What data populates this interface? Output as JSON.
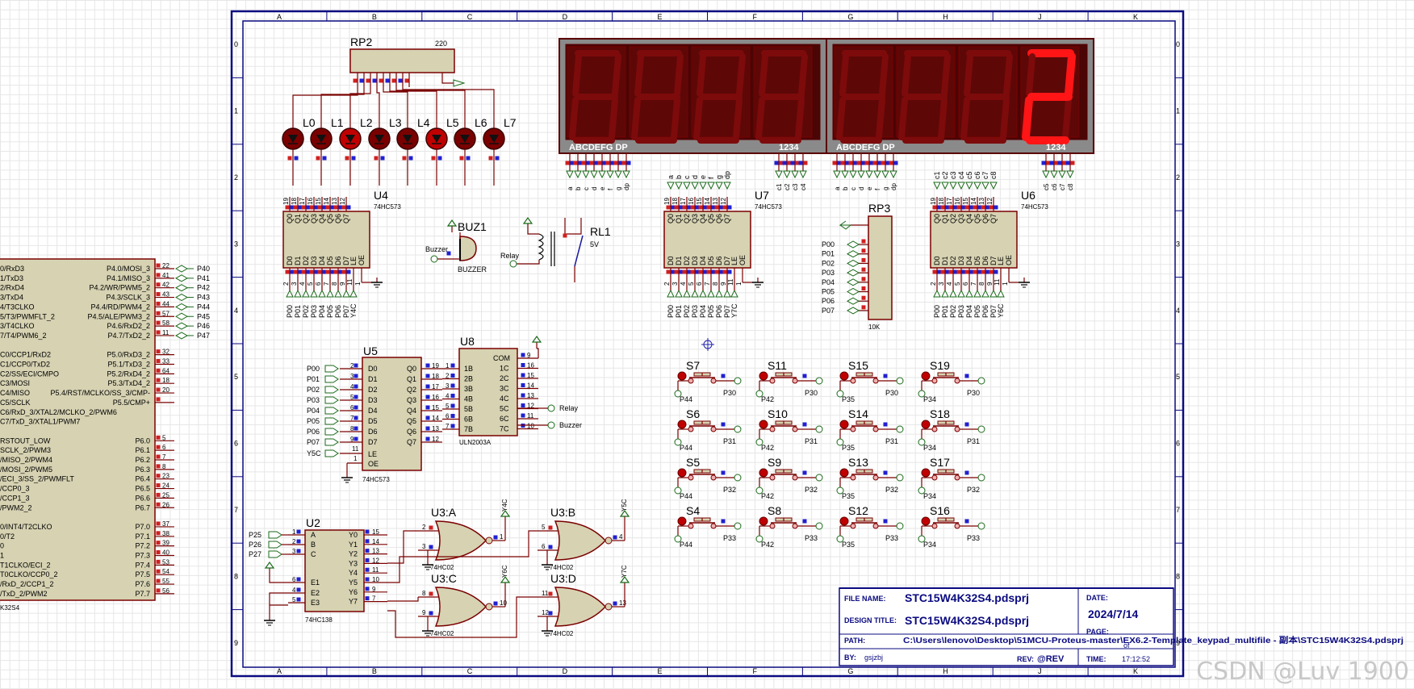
{
  "border_cols": [
    "A",
    "B",
    "C",
    "D",
    "E",
    "F",
    "G",
    "H",
    "J",
    "K"
  ],
  "border_rows": [
    "0",
    "1",
    "2",
    "3",
    "4",
    "5",
    "6",
    "7",
    "8",
    "9"
  ],
  "colors": {
    "wire": "#7a0000",
    "part_fill": "#d6d2b2",
    "part_stroke": "#7a0000",
    "display_bg": "#5a0000",
    "segment_off": "#7d0b0b",
    "segment_on": "#ff1515",
    "pin_red": "#d02020",
    "pin_blue": "#2020d0",
    "text": "#000000",
    "title_text": "#0a0a80"
  },
  "mcu": {
    "name": "K32S4",
    "left_pins": [
      "0/RxD3",
      "1/TxD3",
      "2/RxD4",
      "3/TxD4",
      "4/T3CLKO",
      "5/T3/PWMFLT_2",
      "3/T4CLKO",
      "7/T4/PWM6_2",
      "",
      "C0/CCP1/RxD2",
      "C1/CCP0/TxD2",
      "C2/SS/ECI/CMPO",
      "C3/MOSI",
      "C4/MISO",
      "C5/SCLK",
      "C6/RxD_3/XTAL2/MCLKO_2/PWM6",
      "C7/TxD_3/XTAL1/PWM7",
      "",
      "RSTOUT_LOW",
      "SCLK_2/PWM3",
      "/MISO_2/PWM4",
      "/MOSI_2/PWM5",
      "/ECI_3/SS_2/PWMFLT",
      "/CCP0_3",
      "/CCP1_3",
      "/PWM2_2",
      "",
      "0/INT4/T2CLKO",
      "0/T2",
      "0",
      "1",
      "T1CLKO/ECI_2",
      "T0CLKO/CCP0_2",
      "/RxD_2/CCP1_2",
      "/TxD_2/PWM2"
    ],
    "right_pins": [
      "P4.0/MOSI_3",
      "P4.1/MISO_3",
      "P4.2/WR/PWM5_2",
      "P4.3/SCLK_3",
      "P4.4/RD/PWM4_2",
      "P4.5/ALE/PWM3_2",
      "P4.6/RxD2_2",
      "P4.7/TxD2_2",
      "",
      "P5.0/RxD3_2",
      "P5.1/TxD3_2",
      "P5.2/RxD4_2",
      "P5.3/TxD4_2",
      "P5.4/RST/MCLKO/SS_3/CMP-",
      "P5.5/CMP+",
      "",
      "",
      "",
      "P6.0",
      "P6.1",
      "P6.2",
      "P6.3",
      "P6.4",
      "P6.5",
      "P6.6",
      "P6.7",
      "",
      "P7.0",
      "P7.1",
      "P7.2",
      "P7.3",
      "P7.4",
      "P7.5",
      "P7.6",
      "P7.7"
    ],
    "right_nums": [
      "22",
      "41",
      "42",
      "43",
      "44",
      "57",
      "58",
      "11",
      "",
      "32",
      "33",
      "64",
      "18",
      "20",
      "",
      "",
      "",
      "",
      "5",
      "6",
      "7",
      "8",
      "23",
      "24",
      "25",
      "26",
      "",
      "37",
      "38",
      "39",
      "40",
      "53",
      "54",
      "55",
      "56"
    ],
    "extra": "/RST/MCLKO/SS_3/CMP-",
    "ports": [
      "P40",
      "P41",
      "P42",
      "P43",
      "P44",
      "P45",
      "P46",
      "P47"
    ]
  },
  "rp2": {
    "ref": "RP2",
    "value": "220"
  },
  "leds": {
    "labels": [
      "L0",
      "L1",
      "L2",
      "L3",
      "L4",
      "L5",
      "L6",
      "L7"
    ],
    "lit": [
      false,
      false,
      true,
      false,
      false,
      true,
      false,
      false
    ]
  },
  "latch_pins": {
    "q": [
      "Q0",
      "Q1",
      "Q2",
      "Q3",
      "Q4",
      "Q5",
      "Q6",
      "Q7"
    ],
    "d": [
      "D0",
      "D1",
      "D2",
      "D3",
      "D4",
      "D5",
      "D6",
      "D7"
    ],
    "qnums": [
      "19",
      "18",
      "17",
      "16",
      "15",
      "14",
      "13",
      "12"
    ],
    "dnums": [
      "2",
      "3",
      "4",
      "5",
      "6",
      "7",
      "8",
      "9"
    ],
    "le": "LE",
    "oe": "OE"
  },
  "u4": {
    "ref": "U4",
    "type": "74HC573",
    "bottom": [
      "P00",
      "P01",
      "P02",
      "P03",
      "P04",
      "P05",
      "P06",
      "P07",
      "Y4C"
    ]
  },
  "u7": {
    "ref": "U7",
    "type": "74HC573",
    "top": [
      "a",
      "b",
      "c",
      "d",
      "e",
      "f",
      "g",
      "dp"
    ],
    "bottom": [
      "P00",
      "P01",
      "P02",
      "P03",
      "P04",
      "P05",
      "P06",
      "P07",
      "Y7C"
    ]
  },
  "u6": {
    "ref": "U6",
    "type": "74HC573",
    "top": [
      "c1",
      "c2",
      "c3",
      "c4",
      "c5",
      "c6",
      "c7",
      "c8"
    ],
    "bottom": [
      "P00",
      "P01",
      "P02",
      "P03",
      "P04",
      "P05",
      "P06",
      "P07",
      "Y6C"
    ]
  },
  "rp3": {
    "ref": "RP3",
    "value": "10K",
    "ports": [
      "P00",
      "P01",
      "P02",
      "P03",
      "P04",
      "P05",
      "P06",
      "P07"
    ]
  },
  "buz": {
    "ref": "BUZ1",
    "type": "BUZZER",
    "net": "Buzzer"
  },
  "relay": {
    "ref": "RL1",
    "value": "5V",
    "net": "Relay"
  },
  "displays": [
    {
      "digits": [
        "8",
        "8",
        "8",
        "8"
      ],
      "seg_label": "ABCDEFG DP",
      "com_label": "1234",
      "seg_pins": [
        "a",
        "b",
        "c",
        "d",
        "e",
        "f",
        "g",
        "dp"
      ],
      "com_pins": [
        "c1",
        "c2",
        "c3",
        "c4"
      ]
    },
    {
      "digits": [
        "8",
        "8",
        "8",
        "2"
      ],
      "seg_label": "ABCDEFG DP",
      "com_label": "1234",
      "seg_pins": [
        "a",
        "b",
        "c",
        "d",
        "e",
        "f",
        "g",
        "dp"
      ],
      "com_pins": [
        "c5",
        "c6",
        "c7",
        "c8"
      ]
    }
  ],
  "u5": {
    "ref": "U5",
    "type": "74HC573",
    "in": [
      "P00",
      "P01",
      "P02",
      "P03",
      "P04",
      "P05",
      "P06",
      "P07"
    ],
    "ctrl": "Y5C",
    "d": [
      "D0",
      "D1",
      "D2",
      "D3",
      "D4",
      "D5",
      "D6",
      "D7"
    ],
    "q": [
      "Q0",
      "Q1",
      "Q2",
      "Q3",
      "Q4",
      "Q5",
      "Q6",
      "Q7"
    ],
    "le": "LE",
    "oe": "OE",
    "dnums": [
      "2",
      "3",
      "4",
      "5",
      "6",
      "7",
      "8",
      "9"
    ],
    "qnums": [
      "19",
      "18",
      "17",
      "16",
      "15",
      "14",
      "13",
      "12"
    ]
  },
  "u8": {
    "ref": "U8",
    "type": "ULN2003A",
    "in": [
      "1B",
      "2B",
      "3B",
      "4B",
      "5B",
      "6B",
      "7B"
    ],
    "out": [
      "COM",
      "1C",
      "2C",
      "3C",
      "4C",
      "5C",
      "6C",
      "7C"
    ],
    "innums": [
      "1",
      "2",
      "3",
      "4",
      "5",
      "6",
      "7"
    ],
    "outnums": [
      "9",
      "16",
      "15",
      "14",
      "13",
      "12",
      "11",
      "10"
    ],
    "net_relay": "Relay",
    "net_buzzer": "Buzzer"
  },
  "u2": {
    "ref": "U2",
    "type": "74HC138",
    "in": [
      "P25",
      "P26",
      "P27"
    ],
    "pins_left": [
      "A",
      "B",
      "C",
      "E1",
      "E2",
      "E3"
    ],
    "pins_right": [
      "Y0",
      "Y1",
      "Y2",
      "Y3",
      "Y4",
      "Y5",
      "Y6",
      "Y7"
    ],
    "nums_left": [
      "1",
      "2",
      "3",
      "6",
      "4",
      "5"
    ],
    "nums_right": [
      "15",
      "14",
      "13",
      "12",
      "11",
      "10",
      "9",
      "7"
    ]
  },
  "gates": [
    {
      "ref": "U3:A",
      "type": "74HC02",
      "in": [
        "2",
        "3"
      ],
      "out": "1",
      "net": "Y4C"
    },
    {
      "ref": "U3:B",
      "type": "74HC02",
      "in": [
        "5",
        "6"
      ],
      "out": "4",
      "net": "Y5C"
    },
    {
      "ref": "U3:C",
      "type": "74HC02",
      "in": [
        "8",
        "9"
      ],
      "out": "10",
      "net": "Y6C"
    },
    {
      "ref": "U3:D",
      "type": "74HC02",
      "in": [
        "11",
        "12"
      ],
      "out": "13",
      "net": "Y7C"
    }
  ],
  "switches": [
    [
      "S7",
      "S11",
      "S15",
      "S19"
    ],
    [
      "S6",
      "S10",
      "S14",
      "S18"
    ],
    [
      "S5",
      "S9",
      "S13",
      "S17"
    ],
    [
      "S4",
      "S8",
      "S12",
      "S16"
    ]
  ],
  "switch_left": [
    "P44",
    "P42",
    "P35",
    "P34"
  ],
  "switch_right": [
    "P30",
    "P31",
    "P32",
    "P33"
  ],
  "title_block": {
    "file_name_label": "FILE NAME:",
    "file_name": "STC15W4K32S4.pdsprj",
    "design_title_label": "DESIGN TITLE:",
    "design_title": "STC15W4K32S4.pdsprj",
    "path_label": "PATH:",
    "path": "C:\\Users\\lenovo\\Desktop\\51MCU-Proteus-master\\EX6.2-Template_keypad_multifile - 副本\\STC15W4K32S4.pdsprj",
    "by_label": "BY:",
    "by": "gsjzbj",
    "rev_label": "REV:",
    "rev": "@REV",
    "date_label": "DATE:",
    "date": "2024/7/14",
    "page_label": "PAGE:",
    "page_of": "of",
    "time_label": "TIME:",
    "time": "17:12:52"
  },
  "watermark": "CSDN @Luv 1900"
}
